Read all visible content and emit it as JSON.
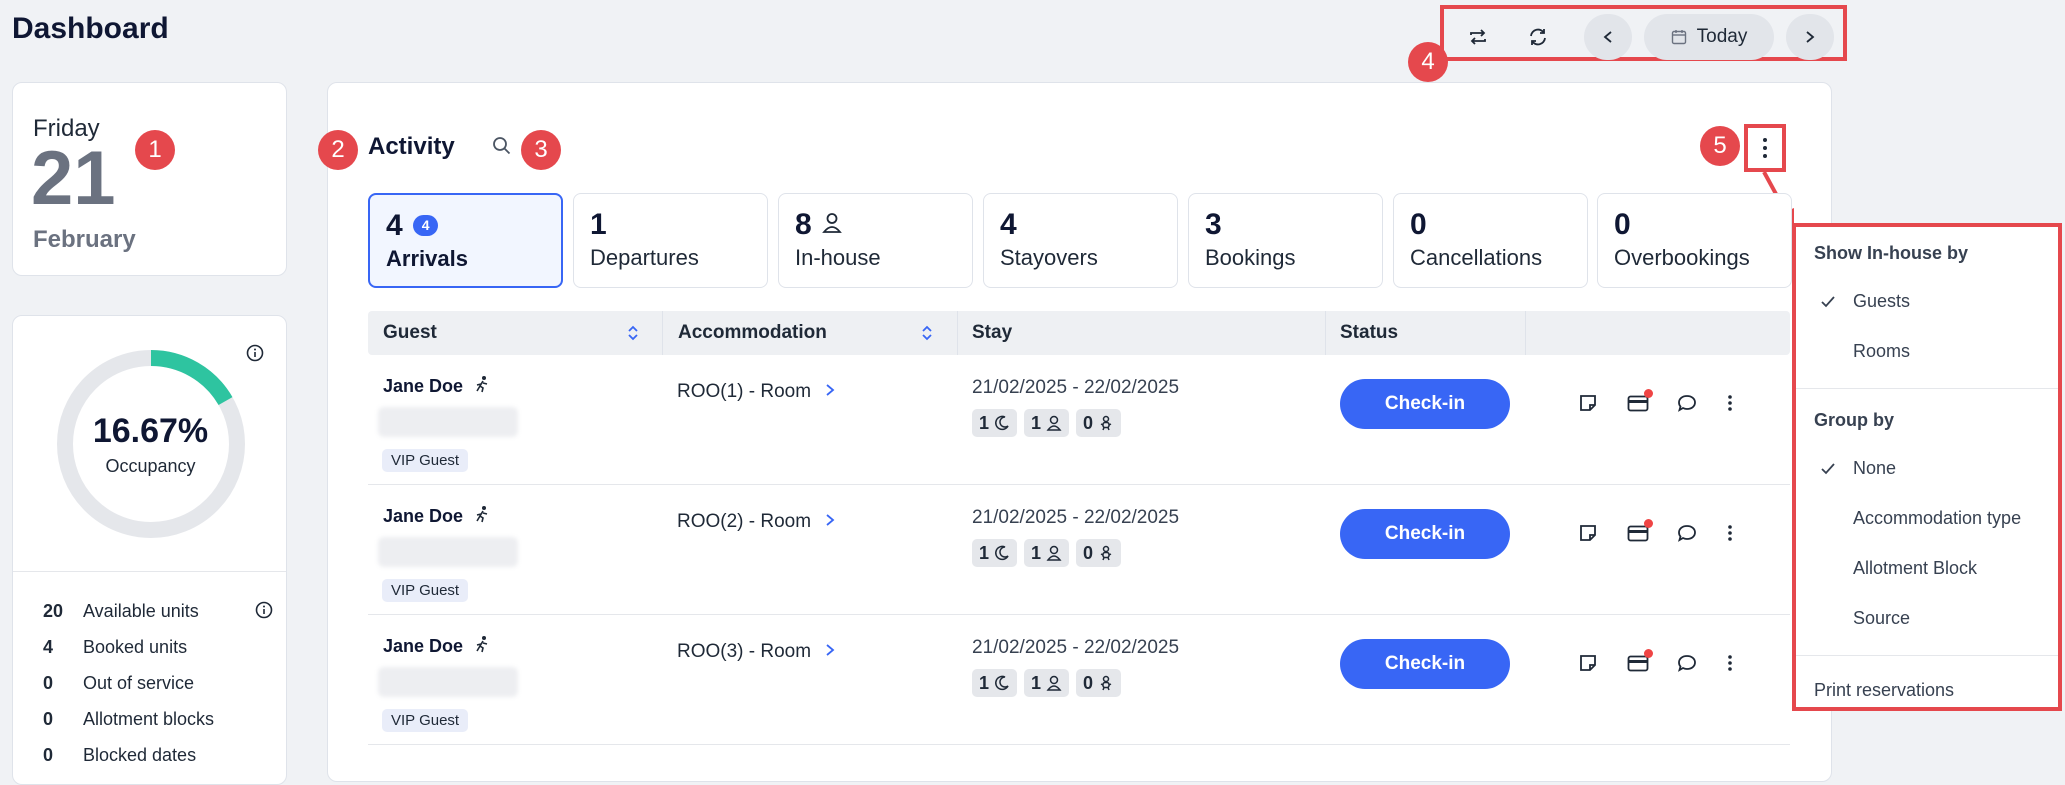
{
  "page": {
    "title": "Dashboard"
  },
  "date_card": {
    "weekday": "Friday",
    "day": "21",
    "month": "February"
  },
  "occupancy": {
    "percent": "16.67%",
    "fraction": 0.1667,
    "label": "Occupancy",
    "stats": [
      {
        "value": "20",
        "label": "Available units"
      },
      {
        "value": "4",
        "label": "Booked units"
      },
      {
        "value": "0",
        "label": "Out of service"
      },
      {
        "value": "0",
        "label": "Allotment blocks"
      },
      {
        "value": "0",
        "label": "Blocked dates"
      }
    ]
  },
  "toolbar": {
    "today_label": "Today"
  },
  "activity": {
    "title": "Activity",
    "tiles": [
      {
        "count": "4",
        "badge": "4",
        "label": "Arrivals"
      },
      {
        "count": "1",
        "label": "Departures"
      },
      {
        "count": "8",
        "label": "In-house"
      },
      {
        "count": "4",
        "label": "Stayovers"
      },
      {
        "count": "3",
        "label": "Bookings"
      },
      {
        "count": "0",
        "label": "Cancellations"
      },
      {
        "count": "0",
        "label": "Overbookings"
      }
    ],
    "columns": [
      "Guest",
      "Accommodation",
      "Stay",
      "Status"
    ],
    "rows": [
      {
        "guest": "Jane Doe",
        "tag": "VIP Guest",
        "accommodation": "ROO(1) - Room",
        "stay": "21/02/2025 - 22/02/2025",
        "nights": "1",
        "adults": "1",
        "children": "0",
        "action": "Check-in"
      },
      {
        "guest": "Jane Doe",
        "tag": "VIP Guest",
        "accommodation": "ROO(2) - Room",
        "stay": "21/02/2025 - 22/02/2025",
        "nights": "1",
        "adults": "1",
        "children": "0",
        "action": "Check-in"
      },
      {
        "guest": "Jane Doe",
        "tag": "VIP Guest",
        "accommodation": "ROO(3) - Room",
        "stay": "21/02/2025 - 22/02/2025",
        "nights": "1",
        "adults": "1",
        "children": "0",
        "action": "Check-in"
      }
    ]
  },
  "menu": {
    "heading1": "Show In-house by",
    "opt_guests": "Guests",
    "opt_rooms": "Rooms",
    "heading2": "Group by",
    "opt_none": "None",
    "opt_acc_type": "Accommodation type",
    "opt_allotment": "Allotment Block",
    "opt_source": "Source",
    "print": "Print reservations"
  },
  "callouts": [
    "1",
    "2",
    "3",
    "4",
    "5"
  ],
  "colors": {
    "accent": "#3866f5",
    "callout": "#e5484d",
    "occupancy_fill": "#2ec4a0"
  }
}
